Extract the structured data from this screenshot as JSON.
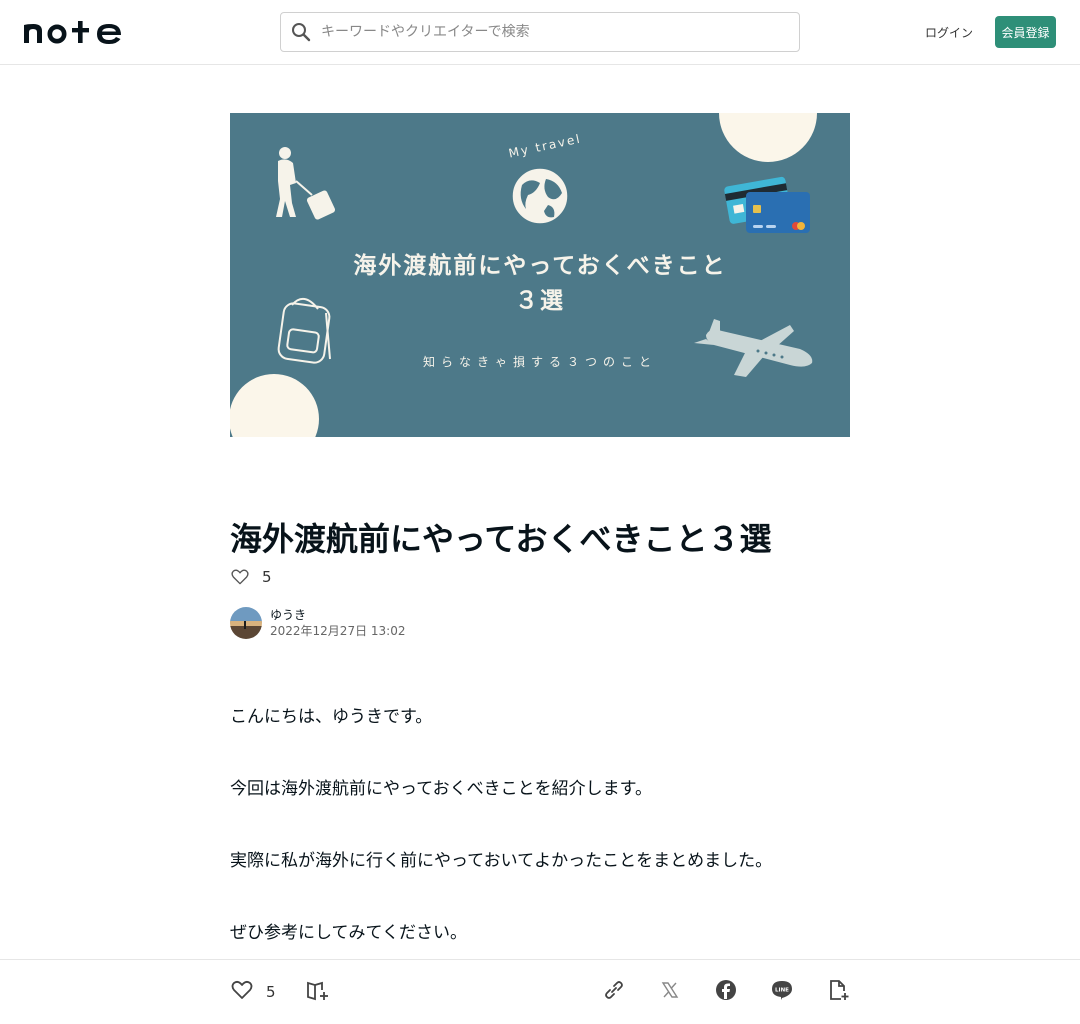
{
  "header": {
    "logo_text": "note",
    "search_placeholder": "キーワードやクリエイターで検索",
    "login_label": "ログイン",
    "signup_label": "会員登録",
    "accent_color": "#2e8f78"
  },
  "hero": {
    "my_travel": "My travel",
    "title_line1": "海外渡航前にやっておくべきこと",
    "title_line2": "３選",
    "subtitle": "知らなきゃ損する３つのこと",
    "background_color": "#4d7989"
  },
  "article": {
    "title": "海外渡航前にやっておくべきこと３選",
    "like_count": "5",
    "author_name": "ゆうき",
    "date": "2022年12月27日 13:02",
    "paragraphs": [
      "こんにちは、ゆうきです。",
      "今回は海外渡航前にやっておくべきことを紹介します。",
      "実際に私が海外に行く前にやっておいてよかったことをまとめました。",
      "ぜひ参考にしてみてください。"
    ]
  },
  "bottom_bar": {
    "like_count": "5",
    "icons": [
      "heart-icon",
      "magazine-add-icon",
      "link-icon",
      "x-icon",
      "facebook-icon",
      "line-icon",
      "note-add-icon"
    ]
  }
}
